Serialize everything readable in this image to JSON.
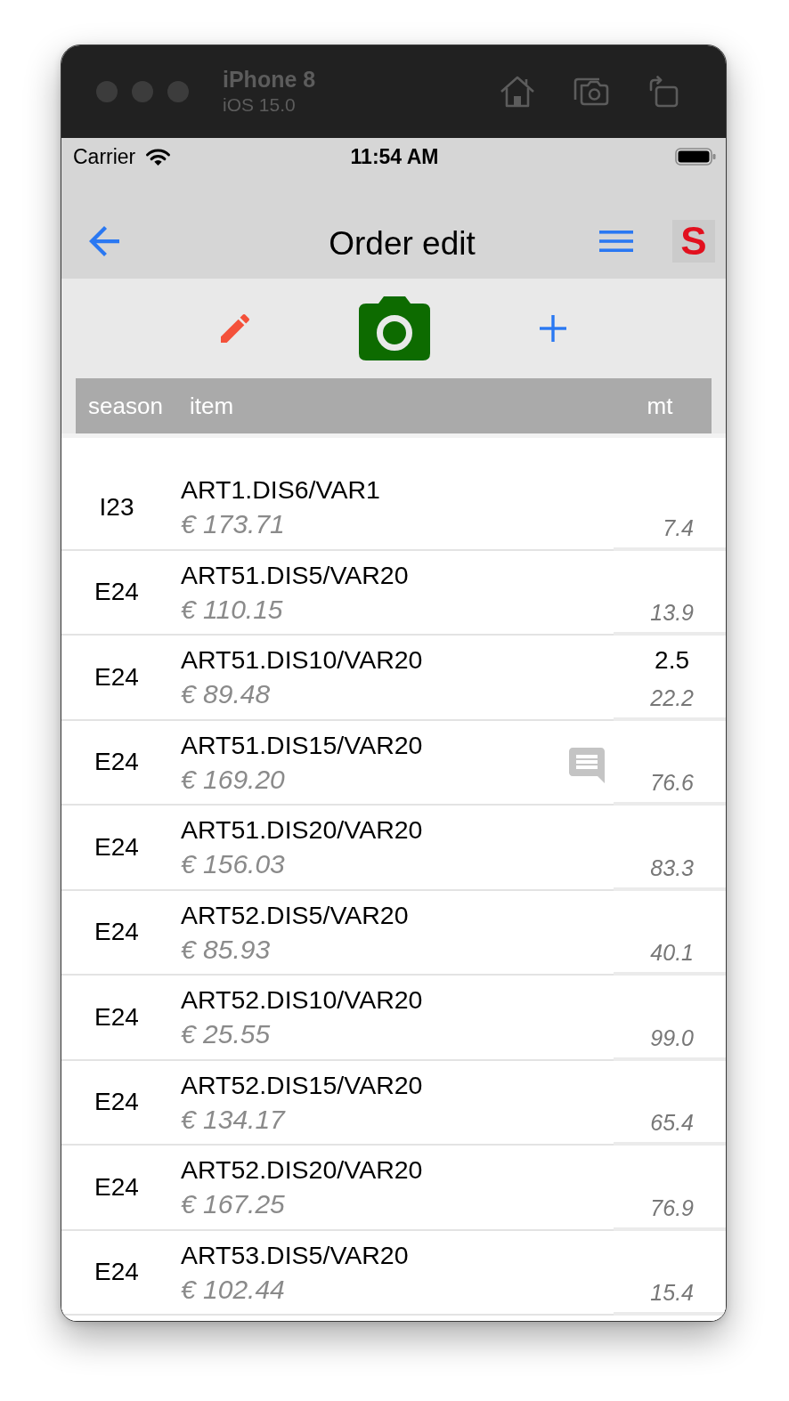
{
  "simulator": {
    "device": "iPhone 8",
    "os": "iOS 15.0"
  },
  "status_bar": {
    "carrier": "Carrier",
    "time": "11:54 AM"
  },
  "nav_bar": {
    "title": "Order edit",
    "logo": "S"
  },
  "table": {
    "columns": [
      "season",
      "item",
      "mt"
    ],
    "rows": [
      {
        "season": "I23",
        "item": "ART1.DIS6/VAR1",
        "price": "€ 173.71",
        "secondary_value": "7.4",
        "has_note": false
      },
      {
        "season": "E24",
        "item": "ART51.DIS5/VAR20",
        "price": "€ 110.15",
        "secondary_value": "13.9",
        "has_note": false
      },
      {
        "season": "E24",
        "item": "ART51.DIS10/VAR20",
        "price": "€ 89.48",
        "mt": "2.5",
        "secondary_value": "22.2",
        "has_note": false
      },
      {
        "season": "E24",
        "item": "ART51.DIS15/VAR20",
        "price": "€ 169.20",
        "secondary_value": "76.6",
        "has_note": true
      },
      {
        "season": "E24",
        "item": "ART51.DIS20/VAR20",
        "price": "€ 156.03",
        "secondary_value": "83.3",
        "has_note": false
      },
      {
        "season": "E24",
        "item": "ART52.DIS5/VAR20",
        "price": "€ 85.93",
        "secondary_value": "40.1",
        "has_note": false
      },
      {
        "season": "E24",
        "item": "ART52.DIS10/VAR20",
        "price": "€ 25.55",
        "secondary_value": "99.0",
        "has_note": false
      },
      {
        "season": "E24",
        "item": "ART52.DIS15/VAR20",
        "price": "€ 134.17",
        "secondary_value": "65.4",
        "has_note": false
      },
      {
        "season": "E24",
        "item": "ART52.DIS20/VAR20",
        "price": "€ 167.25",
        "secondary_value": "76.9",
        "has_note": false
      },
      {
        "season": "E24",
        "item": "ART53.DIS5/VAR20",
        "price": "€ 102.44",
        "secondary_value": "15.4",
        "has_note": false
      }
    ]
  }
}
